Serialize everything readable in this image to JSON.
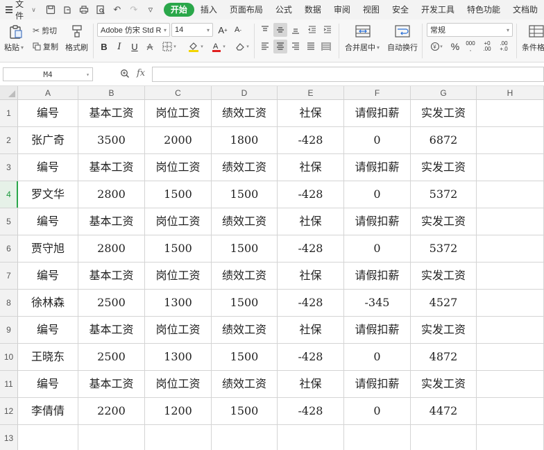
{
  "menubar": {
    "file_label": "文件",
    "tabs": [
      "开始",
      "插入",
      "页面布局",
      "公式",
      "数据",
      "审阅",
      "视图",
      "安全",
      "开发工具",
      "特色功能",
      "文档助"
    ]
  },
  "ribbon": {
    "paste_label": "粘贴",
    "cut_label": "剪切",
    "copy_label": "复制",
    "format_painter_label": "格式刷",
    "font_name": "Adobe 仿宋 Std R",
    "font_size": "14",
    "merge_center_label": "合并居中",
    "wrap_text_label": "自动换行",
    "number_format": "常规",
    "cond_format_label": "条件格"
  },
  "formula_bar": {
    "cell_ref": "M4",
    "fx_label": "fx",
    "value": ""
  },
  "sheet": {
    "columns": [
      "A",
      "B",
      "C",
      "D",
      "E",
      "F",
      "G",
      "H"
    ],
    "rows": [
      "1",
      "2",
      "3",
      "4",
      "5",
      "6",
      "7",
      "8",
      "9",
      "10",
      "11",
      "12",
      "13"
    ],
    "active_row": "4",
    "cells": [
      [
        "编号",
        "基本工资",
        "岗位工资",
        "绩效工资",
        "社保",
        "请假扣薪",
        "实发工资",
        ""
      ],
      [
        "张广奇",
        "3500",
        "2000",
        "1800",
        "-428",
        "0",
        "6872",
        ""
      ],
      [
        "编号",
        "基本工资",
        "岗位工资",
        "绩效工资",
        "社保",
        "请假扣薪",
        "实发工资",
        ""
      ],
      [
        "罗文华",
        "2800",
        "1500",
        "1500",
        "-428",
        "0",
        "5372",
        ""
      ],
      [
        "编号",
        "基本工资",
        "岗位工资",
        "绩效工资",
        "社保",
        "请假扣薪",
        "实发工资",
        ""
      ],
      [
        "贾守旭",
        "2800",
        "1500",
        "1500",
        "-428",
        "0",
        "5372",
        ""
      ],
      [
        "编号",
        "基本工资",
        "岗位工资",
        "绩效工资",
        "社保",
        "请假扣薪",
        "实发工资",
        ""
      ],
      [
        "徐林森",
        "2500",
        "1300",
        "1500",
        "-428",
        "-345",
        "4527",
        ""
      ],
      [
        "编号",
        "基本工资",
        "岗位工资",
        "绩效工资",
        "社保",
        "请假扣薪",
        "实发工资",
        ""
      ],
      [
        "王晓东",
        "2500",
        "1300",
        "1500",
        "-428",
        "0",
        "4872",
        ""
      ],
      [
        "编号",
        "基本工资",
        "岗位工资",
        "绩效工资",
        "社保",
        "请假扣薪",
        "实发工资",
        ""
      ],
      [
        "李倩倩",
        "2200",
        "1200",
        "1500",
        "-428",
        "0",
        "4472",
        ""
      ],
      [
        "",
        "",
        "",
        "",
        "",
        "",
        "",
        ""
      ]
    ]
  },
  "colors": {
    "accent": "#2aa74a",
    "header_bg": "#f2f2f2",
    "gridline": "#d4d4d4"
  }
}
